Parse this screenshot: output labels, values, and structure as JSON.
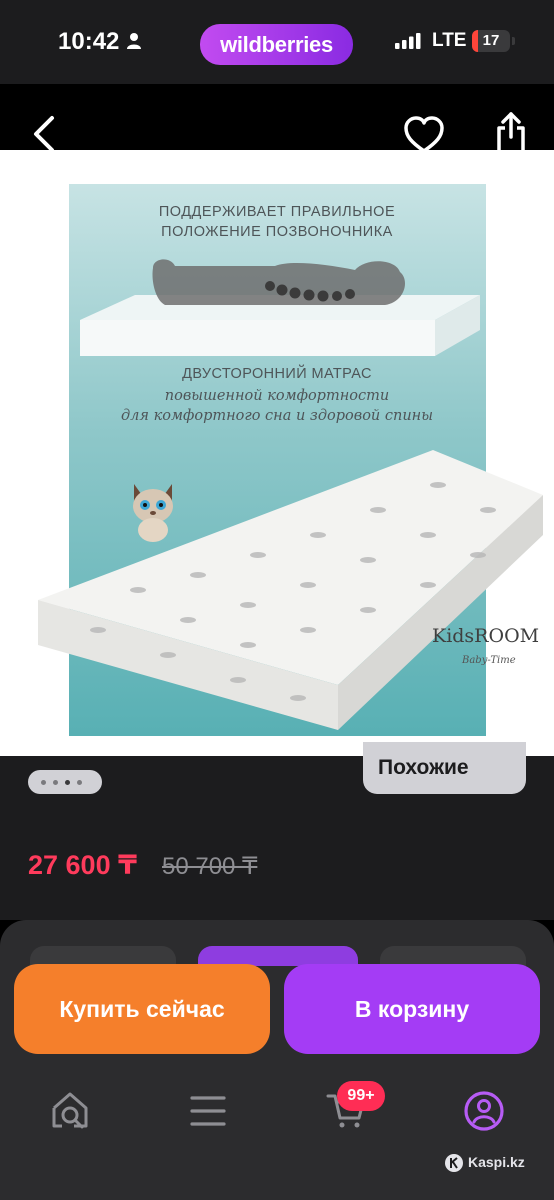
{
  "status_bar": {
    "time": "10:42",
    "app_brand": "wildberries",
    "network": "LTE",
    "battery": "17",
    "battery_level": 0.17
  },
  "product_image": {
    "heading_line1": "ПОДДЕРЖИВАЕТ ПРАВИЛЬНОЕ",
    "heading_line2": "ПОЛОЖЕНИЕ ПОЗВОНОЧНИКА",
    "subheading": "ДВУСТОРОННИЙ МАТРАС",
    "tagline_line1": "повышенной комфортности",
    "tagline_line2": "для комфортного сна и здоровой спины",
    "brand_logo": "KidsROOM",
    "brand_logo_sub": "Baby-Time"
  },
  "product_info": {
    "similar_label": "Похожие",
    "price_current": "27 600 ₸",
    "price_old": "50 700 ₸"
  },
  "actions": {
    "buy_now": "Купить сейчас",
    "add_to_cart": "В корзину"
  },
  "bottom_nav": {
    "cart_badge": "99+"
  },
  "watermark": "Kaspi.kz",
  "colors": {
    "price": "#ff3b5c",
    "buy_now": "#f57f2b",
    "cart": "#a43cf5",
    "brand_gradient_start": "#c24bf0",
    "brand_gradient_end": "#8a2be2",
    "badge": "#ff2d55",
    "profile_icon": "#b75cf5"
  }
}
